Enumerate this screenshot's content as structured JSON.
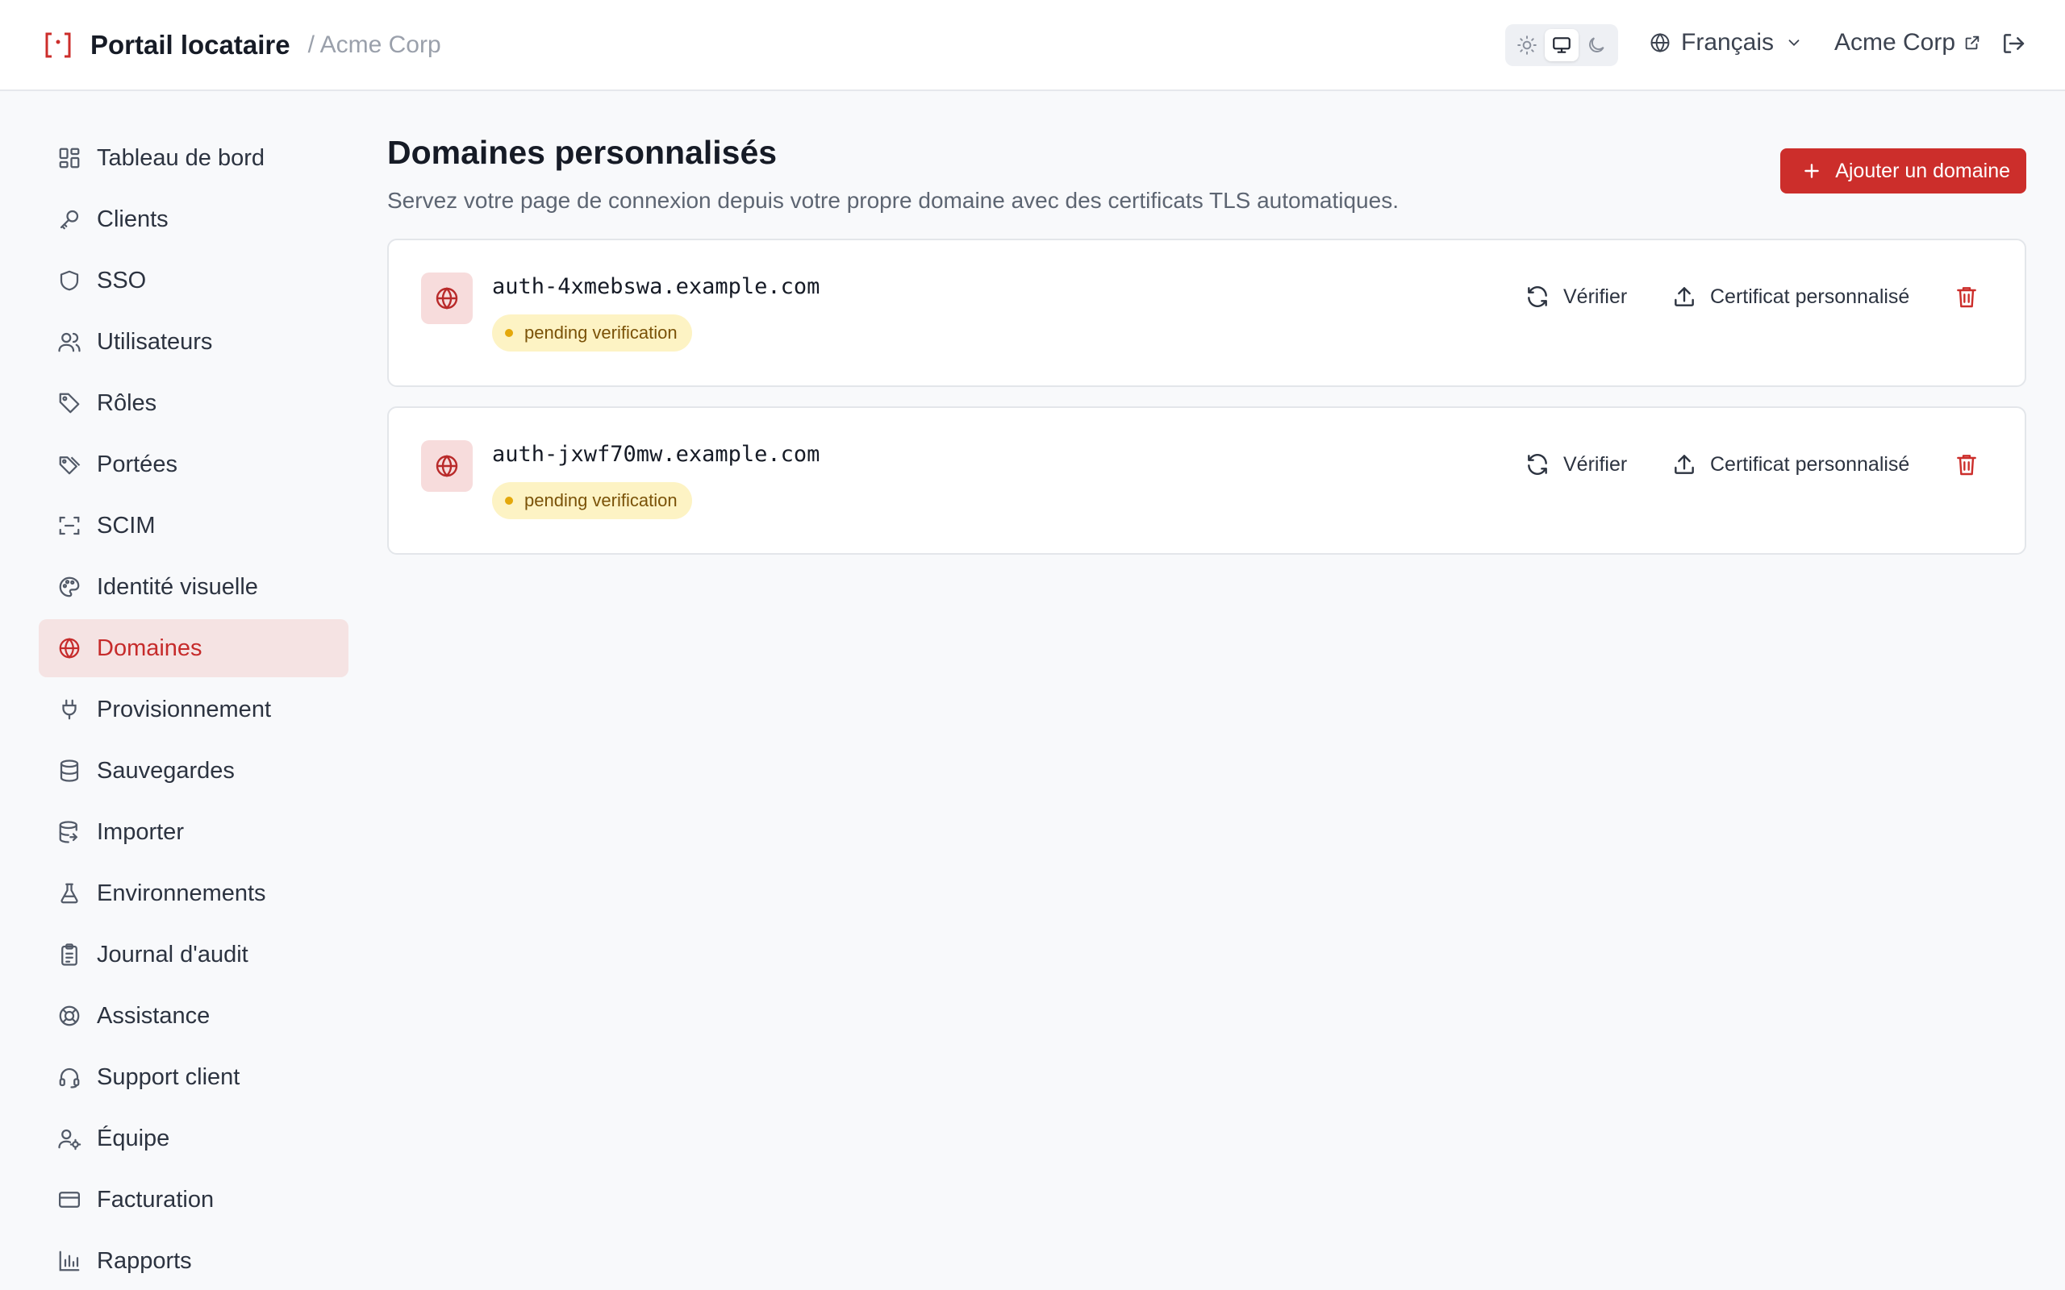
{
  "app": {
    "title": "Portail locataire",
    "tenant": "/ Acme Corp"
  },
  "topbar": {
    "language": "Français",
    "organization": "Acme Corp",
    "theme_options": [
      "light-icon",
      "monitor-icon",
      "moon-icon"
    ],
    "theme_selected": "monitor"
  },
  "sidebar": {
    "items": [
      {
        "label": "Tableau de bord",
        "icon": "dashboard-icon"
      },
      {
        "label": "Clients",
        "icon": "key-icon"
      },
      {
        "label": "SSO",
        "icon": "shield-icon"
      },
      {
        "label": "Utilisateurs",
        "icon": "users-icon"
      },
      {
        "label": "Rôles",
        "icon": "tag-icon"
      },
      {
        "label": "Portées",
        "icon": "tags-icon"
      },
      {
        "label": "SCIM",
        "icon": "scan-icon"
      },
      {
        "label": "Identité visuelle",
        "icon": "palette-icon"
      },
      {
        "label": "Domaines",
        "icon": "globe-icon"
      },
      {
        "label": "Provisionnement",
        "icon": "plug-icon"
      },
      {
        "label": "Sauvegardes",
        "icon": "database-icon"
      },
      {
        "label": "Importer",
        "icon": "database-import-icon"
      },
      {
        "label": "Environnements",
        "icon": "flask-icon"
      },
      {
        "label": "Journal d'audit",
        "icon": "clipboard-icon"
      },
      {
        "label": "Assistance",
        "icon": "lifebuoy-icon"
      },
      {
        "label": "Support client",
        "icon": "headset-icon"
      },
      {
        "label": "Équipe",
        "icon": "user-cog-icon"
      },
      {
        "label": "Facturation",
        "icon": "credit-card-icon"
      },
      {
        "label": "Rapports",
        "icon": "bar-chart-icon"
      }
    ],
    "active": "Domaines"
  },
  "main": {
    "title": "Domaines personnalisés",
    "subtitle": "Servez votre page de connexion depuis votre propre domaine avec des certificats TLS automatiques.",
    "add_button": "Ajouter un domaine",
    "domains": [
      {
        "name": "auth-4xmebswa.example.com",
        "status": "pending verification"
      },
      {
        "name": "auth-jxwf70mw.example.com",
        "status": "pending verification"
      }
    ],
    "actions": {
      "verify": "Vérifier",
      "custom_cert": "Certificat personnalisé"
    }
  },
  "colors": {
    "accent": "#cc2e2b",
    "active_nav_bg": "#f5e3e3",
    "badge_bg": "#fdf3c4",
    "badge_dot": "#e4a80b"
  }
}
